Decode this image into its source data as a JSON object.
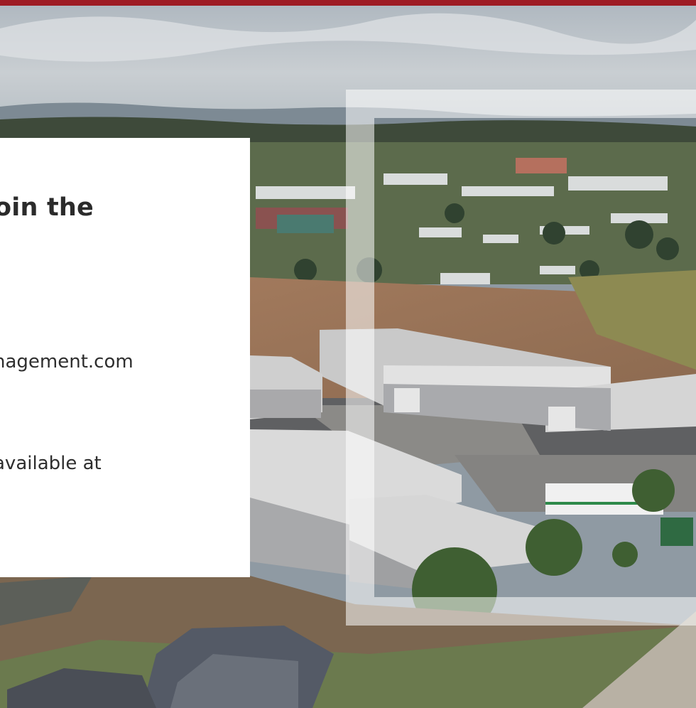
{
  "colors": {
    "brand_bar": "#9e1c24",
    "card_bg": "#ffffff",
    "text": "#2b2b2b"
  },
  "card": {
    "heading": "oin the",
    "email_text": "nagement.com",
    "available_text": "available at"
  },
  "background": {
    "icon": "aerial-industrial-park-photo"
  }
}
